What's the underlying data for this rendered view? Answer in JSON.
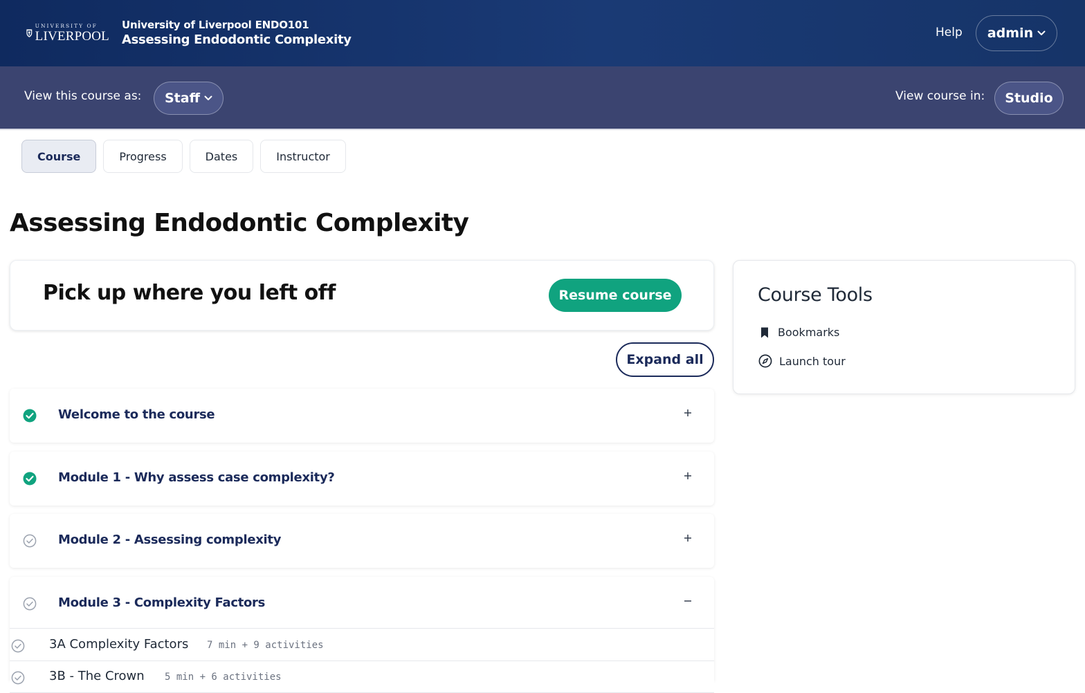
{
  "header": {
    "logo_small": "UNIVERSITY OF",
    "logo_big": "LIVERPOOL",
    "org": "University of Liverpool ENDO101",
    "course_title": "Assessing Endodontic Complexity",
    "help": "Help",
    "user": "admin"
  },
  "subheader": {
    "view_as_label": "View this course as:",
    "view_as_value": "Staff",
    "view_in_label": "View course in:",
    "view_in_value": "Studio"
  },
  "tabs": [
    {
      "label": "Course",
      "active": true
    },
    {
      "label": "Progress",
      "active": false
    },
    {
      "label": "Dates",
      "active": false
    },
    {
      "label": "Instructor",
      "active": false
    }
  ],
  "page_title": "Assessing Endodontic Complexity",
  "resume": {
    "title": "Pick up where you left off",
    "button": "Resume course"
  },
  "expand_all": "Expand all",
  "sections": [
    {
      "title": "Welcome to the course",
      "complete": true,
      "expanded": false
    },
    {
      "title": "Module 1 - Why assess case complexity?",
      "complete": true,
      "expanded": false
    },
    {
      "title": "Module 2 - Assessing complexity",
      "complete": false,
      "expanded": false
    },
    {
      "title": "Module 3 - Complexity Factors",
      "complete": false,
      "expanded": true
    }
  ],
  "subsections": [
    {
      "title": "3A Complexity Factors",
      "meta": "7 min + 9 activities"
    },
    {
      "title": "3B - The Crown",
      "meta": "5 min + 6 activities"
    }
  ],
  "course_tools": {
    "title": "Course Tools",
    "items": [
      {
        "label": "Bookmarks",
        "icon": "bookmark-icon"
      },
      {
        "label": "Launch tour",
        "icon": "compass-icon"
      }
    ]
  },
  "colors": {
    "header_bg": "#0f2a5f",
    "subheader_bg": "#3b4470",
    "accent_green": "#10a37f",
    "navy_text": "#1b2a5a"
  }
}
